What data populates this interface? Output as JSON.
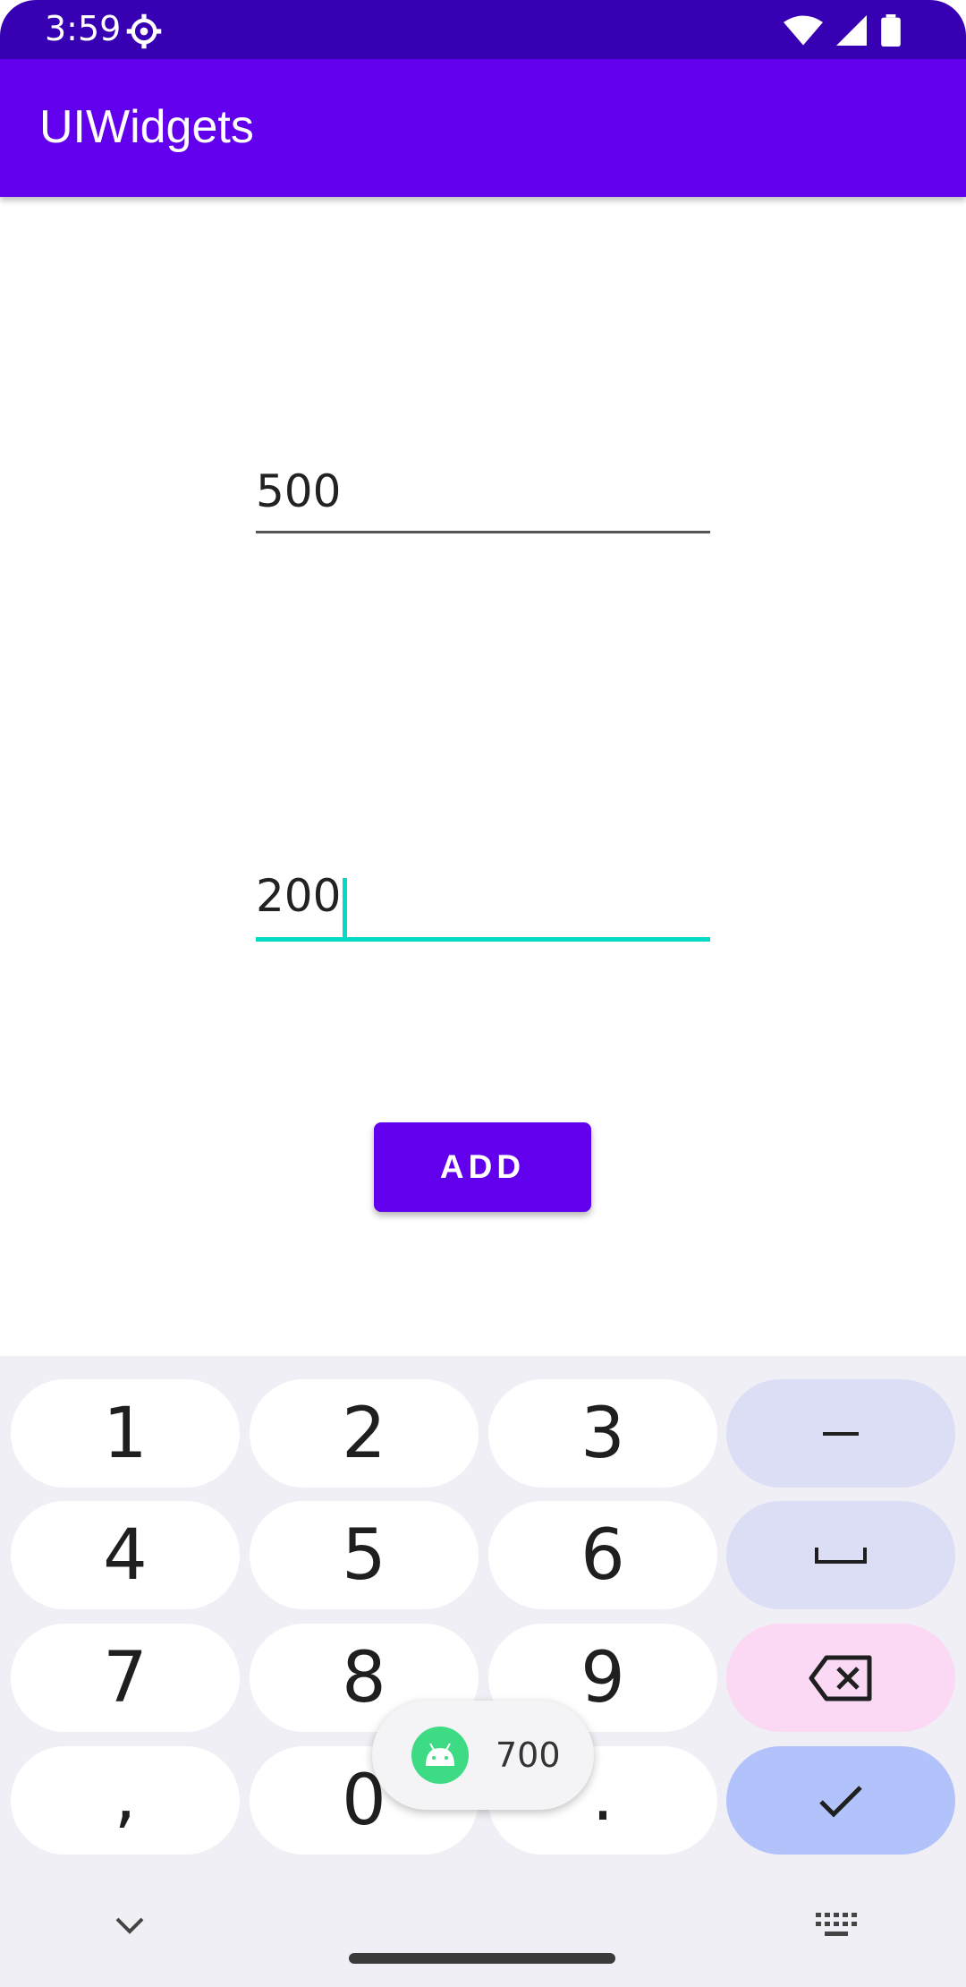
{
  "status_bar": {
    "time": "3:59"
  },
  "app_bar": {
    "title": "UIWidgets"
  },
  "form": {
    "first_value": "500",
    "second_value": "200",
    "add_label": "ADD"
  },
  "keyboard": {
    "keys": [
      "1",
      "2",
      "3",
      "–",
      "4",
      "5",
      "6",
      "␣",
      "7",
      "8",
      "9",
      "⌫",
      ",",
      "0",
      ".",
      "✓"
    ]
  },
  "toast": {
    "text": "700"
  },
  "colors": {
    "primary": "#6200ee",
    "primary_dark": "#3700b3",
    "accent": "#03dac5"
  }
}
